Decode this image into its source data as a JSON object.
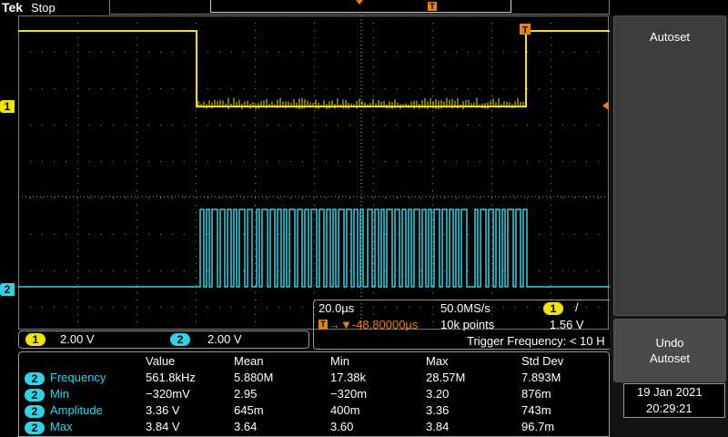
{
  "topbar": {
    "brand": "Tek",
    "acq_state": "Stop",
    "trigger_pos_marker": "T"
  },
  "channels": {
    "ch1": {
      "marker": "1",
      "scale": "2.00 V",
      "color": "#f2e600"
    },
    "ch2": {
      "marker": "2",
      "scale": "2.00 V",
      "color": "#2fd3e6"
    }
  },
  "horizontal": {
    "time_div": "20.0µs",
    "sample_rate": "50.0MS/s",
    "trigger_icon": "T",
    "delay": "→▼-48.80000µs",
    "record_length": "10k points",
    "trigger_source": "1",
    "trigger_slope": "/",
    "trigger_level": "1.56 V",
    "trigger_frequency": "Trigger Frequency: < 10 H"
  },
  "measurements": {
    "headers": [
      "Value",
      "Mean",
      "Min",
      "Max",
      "Std Dev"
    ],
    "rows": [
      {
        "ch": "2",
        "name": "Frequency",
        "cells": [
          "561.8kHz",
          "5.880M",
          "17.38k",
          "28.57M",
          "7.893M"
        ]
      },
      {
        "ch": "2",
        "name": "Min",
        "cells": [
          "−320mV",
          "2.95",
          "−320m",
          "3.20",
          "876m"
        ]
      },
      {
        "ch": "2",
        "name": "Amplitude",
        "cells": [
          "3.36 V",
          "645m",
          "400m",
          "3.36",
          "743m"
        ]
      },
      {
        "ch": "2",
        "name": "Max",
        "cells": [
          "3.84 V",
          "3.64",
          "3.60",
          "3.84",
          "96.7m"
        ]
      }
    ]
  },
  "side_menu": {
    "autoset": "Autoset",
    "undo_autoset": "Undo\nAutoset"
  },
  "datetime": {
    "date": "19 Jan  2021",
    "time": "20:29:21"
  },
  "colors": {
    "ch1": "#f2e600",
    "ch2": "#2fd3e6",
    "trigger": "#e8820a",
    "grid": "#8c8c8c"
  }
}
